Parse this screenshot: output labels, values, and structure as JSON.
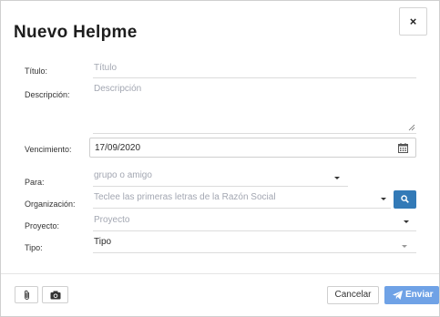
{
  "modal": {
    "title": "Nuevo Helpme",
    "close_label": "×"
  },
  "form": {
    "titulo": {
      "label": "Título:",
      "placeholder": "Título"
    },
    "descripcion": {
      "label": "Descripción:",
      "placeholder": "Descripción"
    },
    "vencimiento": {
      "label": "Vencimiento:",
      "value": "17/09/2020",
      "icon": "calendar-icon"
    },
    "para": {
      "label": "Para:",
      "placeholder": "grupo o amigo"
    },
    "organizacion": {
      "label": "Organización:",
      "placeholder": "Teclee las primeras letras de la Razón Social",
      "search_icon": "search-icon"
    },
    "proyecto": {
      "label": "Proyecto:",
      "placeholder": "Proyecto"
    },
    "tipo": {
      "label": "Tipo:",
      "value": "Tipo"
    }
  },
  "footer": {
    "attach_icon": "paperclip-icon",
    "camera_icon": "camera-icon",
    "cancel_label": "Cancelar",
    "send_label": "Enviar",
    "send_icon": "paper-plane-icon"
  },
  "colors": {
    "primary": "#337ab7",
    "send_button": "#6fa2e6",
    "placeholder": "#a3a7b2",
    "backdrop": "#3d4a2f"
  }
}
